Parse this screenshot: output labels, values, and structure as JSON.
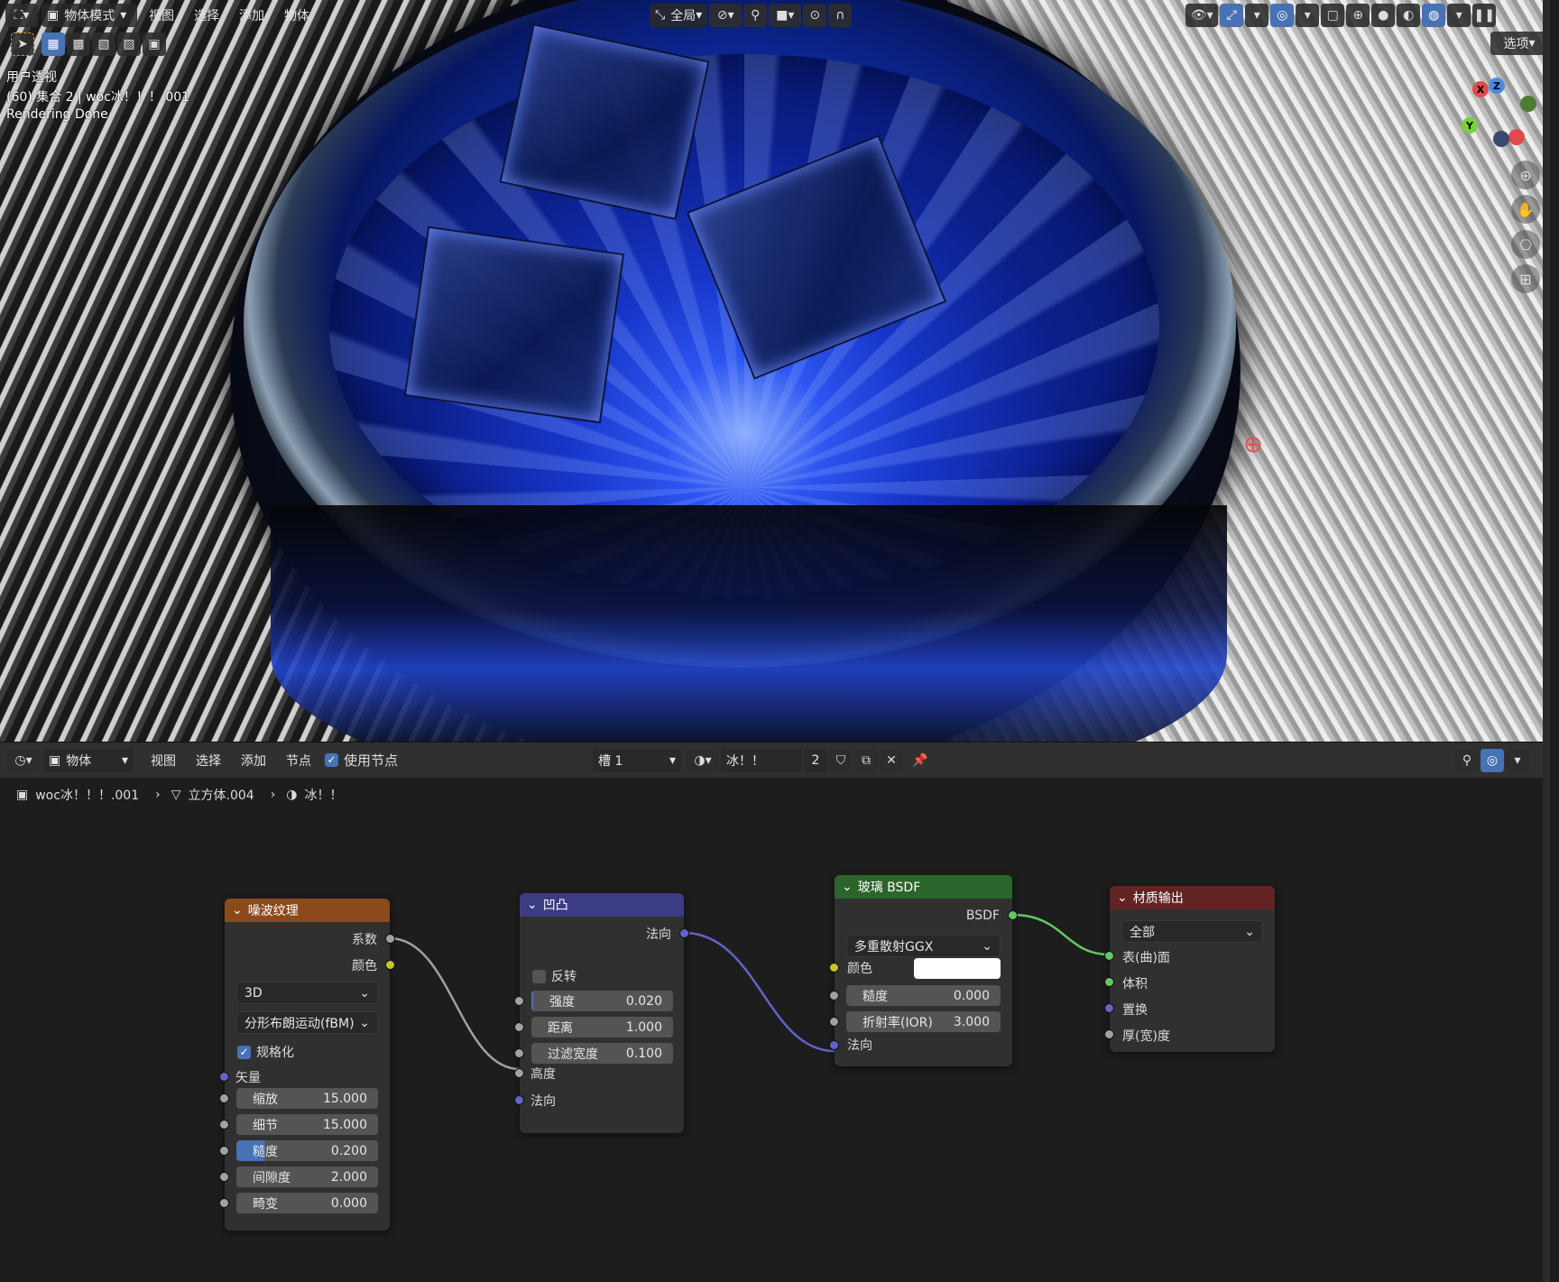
{
  "viewport": {
    "header": {
      "mode": "物体模式",
      "menus": [
        "视图",
        "选择",
        "添加",
        "物体"
      ],
      "orientation": "全局",
      "options": "选项"
    },
    "overlay": {
      "view": "用户透视",
      "collection": "(60) 集合 2 | woc冰！！！.001",
      "status": "Rendering Done"
    },
    "gizmo": {
      "x": "X",
      "y": "Y",
      "z": "Z"
    }
  },
  "node_editor": {
    "header": {
      "type": "物体",
      "menus": [
        "视图",
        "选择",
        "添加",
        "节点"
      ],
      "use_nodes": "使用节点",
      "slot": "槽 1",
      "material": "冰！！",
      "users": "2"
    },
    "breadcrumb": {
      "object": "woc冰！！！.001",
      "mesh": "立方体.004",
      "material": "冰！！"
    },
    "nodes": {
      "noise": {
        "title": "噪波纹理",
        "out_fac": "系数",
        "out_color": "颜色",
        "dimensions": "3D",
        "type": "分形布朗运动(fBM)",
        "normalize": "规格化",
        "vector": "矢量",
        "fields": [
          {
            "label": "缩放",
            "value": "15.000"
          },
          {
            "label": "细节",
            "value": "15.000"
          },
          {
            "label": "糙度",
            "value": "0.200"
          },
          {
            "label": "间隙度",
            "value": "2.000"
          },
          {
            "label": "畸变",
            "value": "0.000"
          }
        ]
      },
      "bump": {
        "title": "凹凸",
        "out_normal": "法向",
        "invert": "反转",
        "fields": [
          {
            "label": "强度",
            "value": "0.020"
          },
          {
            "label": "距离",
            "value": "1.000"
          },
          {
            "label": "过滤宽度",
            "value": "0.100"
          }
        ],
        "in_height": "高度",
        "in_normal": "法向"
      },
      "glass": {
        "title": "玻璃 BSDF",
        "out": "BSDF",
        "distribution": "多重散射GGX",
        "color_label": "颜色",
        "fields": [
          {
            "label": "糙度",
            "value": "0.000"
          },
          {
            "label": "折射率(IOR)",
            "value": "3.000"
          }
        ],
        "in_normal": "法向"
      },
      "output": {
        "title": "材质输出",
        "target": "全部",
        "inputs": [
          "表(曲)面",
          "体积",
          "置换",
          "厚(宽)度"
        ]
      }
    }
  },
  "colors": {
    "noise_header": "#8b4a1c",
    "bump_header": "#3c3c83",
    "glass_header": "#2b652b",
    "output_header": "#642323",
    "socket_gray": "#a1a1a1",
    "socket_yellow": "#c7c729",
    "socket_purple": "#6363c7",
    "socket_green": "#63c763",
    "accent": "#4772b3"
  }
}
